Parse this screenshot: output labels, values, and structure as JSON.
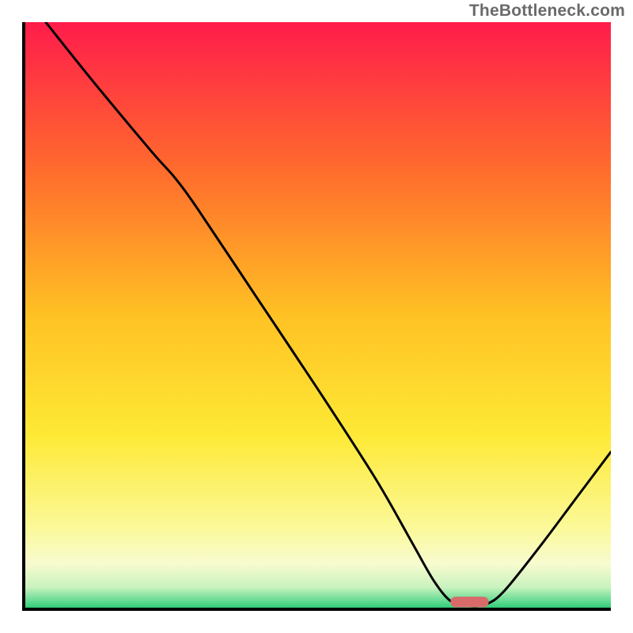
{
  "attribution": "TheBottleneck.com",
  "chart_data": {
    "type": "line",
    "title": "",
    "xlabel": "",
    "ylabel": "",
    "xlim": [
      0,
      100
    ],
    "ylim": [
      0,
      100
    ],
    "gradient_stops": [
      {
        "offset": 0.0,
        "color": "#ff1c4b"
      },
      {
        "offset": 0.25,
        "color": "#ff6b2d"
      },
      {
        "offset": 0.5,
        "color": "#ffc224"
      },
      {
        "offset": 0.7,
        "color": "#fee935"
      },
      {
        "offset": 0.86,
        "color": "#fbf99a"
      },
      {
        "offset": 0.92,
        "color": "#f8fbcf"
      },
      {
        "offset": 0.96,
        "color": "#c9f2be"
      },
      {
        "offset": 0.985,
        "color": "#5bd98f"
      },
      {
        "offset": 1.0,
        "color": "#1bc46a"
      }
    ],
    "curve": {
      "description": "bottleneck curve descending from top-left, dipping to minimum near x≈76, then rising to right edge",
      "points": [
        {
          "x": 4.0,
          "y": 100.0
        },
        {
          "x": 12.0,
          "y": 90.0
        },
        {
          "x": 22.0,
          "y": 78.0
        },
        {
          "x": 26.0,
          "y": 73.5
        },
        {
          "x": 30.0,
          "y": 68.0
        },
        {
          "x": 40.0,
          "y": 53.0
        },
        {
          "x": 50.0,
          "y": 38.0
        },
        {
          "x": 60.0,
          "y": 22.5
        },
        {
          "x": 66.0,
          "y": 12.0
        },
        {
          "x": 70.0,
          "y": 5.0
        },
        {
          "x": 73.0,
          "y": 1.5
        },
        {
          "x": 76.0,
          "y": 0.8
        },
        {
          "x": 79.0,
          "y": 1.2
        },
        {
          "x": 82.0,
          "y": 3.5
        },
        {
          "x": 88.0,
          "y": 11.0
        },
        {
          "x": 94.0,
          "y": 19.0
        },
        {
          "x": 100.0,
          "y": 27.0
        }
      ]
    },
    "marker": {
      "x": 76.0,
      "y": 1.5,
      "width": 6.5,
      "height": 1.8,
      "color": "#d86a6a"
    },
    "axes_color": "#000000",
    "axes_width": 4
  }
}
